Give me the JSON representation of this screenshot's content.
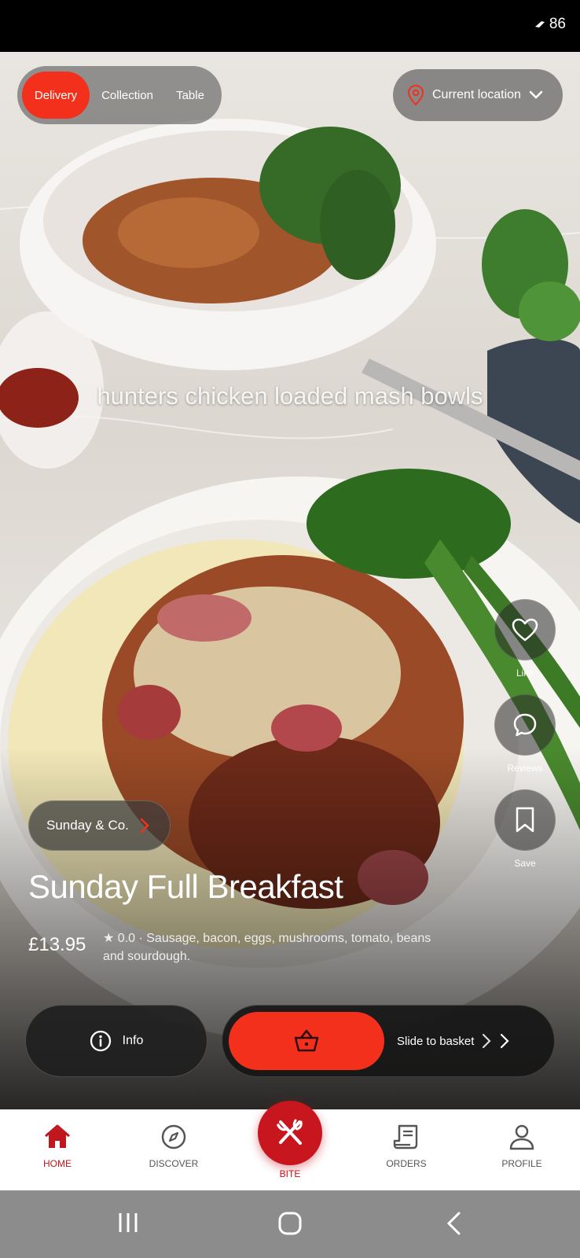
{
  "status_bar": {
    "battery": "86"
  },
  "video": {
    "caption": "hunters chicken loaded mash bowls"
  },
  "order_mode": {
    "options": [
      "Delivery",
      "Collection",
      "Table"
    ],
    "selected": "Delivery"
  },
  "location": {
    "label": "Current location",
    "icon": "map-pin-icon"
  },
  "side_actions": [
    {
      "label": "Like",
      "icon": "heart-icon"
    },
    {
      "label": "Reviews",
      "icon": "chat-bubble-icon"
    },
    {
      "label": "Save",
      "icon": "bookmark-icon"
    }
  ],
  "restaurant": {
    "name": "Sunday & Co."
  },
  "dish": {
    "title": "Sunday Full Breakfast",
    "price": "£13.95",
    "meta": "★ 0.0 · Sausage, bacon, eggs, mushrooms, tomato, beans and sourdough."
  },
  "actions": {
    "info_label": "Info",
    "slide_label": "Slide to basket"
  },
  "bottom_nav": {
    "items": [
      {
        "label": "HOME",
        "icon": "home-icon",
        "active": true
      },
      {
        "label": "DISCOVER",
        "icon": "compass-icon",
        "active": false
      },
      {
        "label": "BITE",
        "icon": "fork-knife-icon",
        "active": false
      },
      {
        "label": "ORDERS",
        "icon": "receipt-icon",
        "active": false
      },
      {
        "label": "PROFILE",
        "icon": "person-icon",
        "active": false
      }
    ]
  },
  "colors": {
    "accent": "#f2301c",
    "brand": "#c8161e"
  }
}
